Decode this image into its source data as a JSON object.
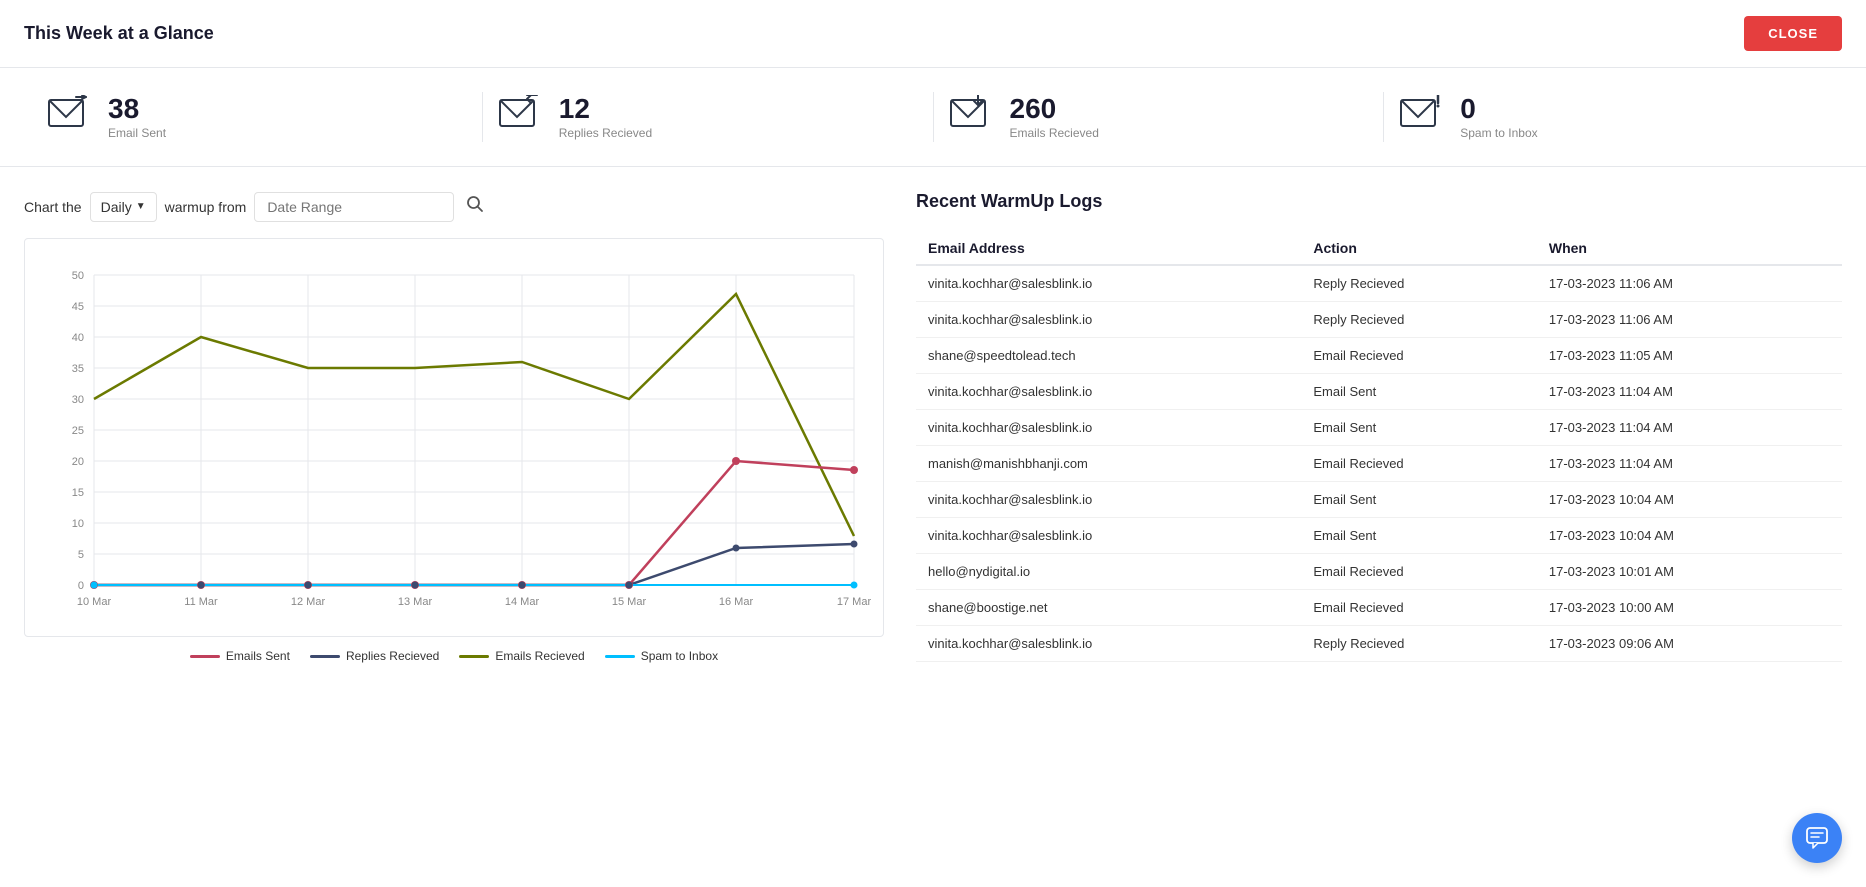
{
  "header": {
    "title": "This Week at a Glance",
    "close_label": "CLOSE"
  },
  "stats": [
    {
      "id": "email-sent",
      "value": "38",
      "label": "Email Sent",
      "icon": "send-email"
    },
    {
      "id": "replies-received",
      "value": "12",
      "label": "Replies Recieved",
      "icon": "reply-email"
    },
    {
      "id": "emails-received",
      "value": "260",
      "label": "Emails Recieved",
      "icon": "inbox-email"
    },
    {
      "id": "spam-to-inbox",
      "value": "0",
      "label": "Spam to Inbox",
      "icon": "spam-email"
    }
  ],
  "chart": {
    "controls": {
      "prefix_label": "Chart the",
      "dropdown_value": "Daily",
      "suffix_label": "warmup from",
      "date_range_placeholder": "Date Range"
    },
    "x_labels": [
      "10 Mar",
      "11 Mar",
      "12 Mar",
      "13 Mar",
      "14 Mar",
      "15 Mar",
      "16 Mar",
      "17 Mar"
    ],
    "y_labels": [
      "0",
      "5",
      "10",
      "15",
      "20",
      "25",
      "30",
      "35",
      "40",
      "45",
      "50"
    ],
    "legend": [
      {
        "label": "Emails Sent",
        "color": "#c0405c"
      },
      {
        "label": "Replies Recieved",
        "color": "#3d4a6e"
      },
      {
        "label": "Emails Recieved",
        "color": "#6b7a00"
      },
      {
        "label": "Spam to Inbox",
        "color": "#00bfff"
      }
    ]
  },
  "recent_logs": {
    "title": "Recent WarmUp Logs",
    "columns": [
      "Email Address",
      "Action",
      "When"
    ],
    "rows": [
      {
        "email": "vinita.kochhar@salesblink.io",
        "action": "Reply Recieved",
        "when": "17-03-2023 11:06 AM"
      },
      {
        "email": "vinita.kochhar@salesblink.io",
        "action": "Reply Recieved",
        "when": "17-03-2023 11:06 AM"
      },
      {
        "email": "shane@speedtolead.tech",
        "action": "Email Recieved",
        "when": "17-03-2023 11:05 AM"
      },
      {
        "email": "vinita.kochhar@salesblink.io",
        "action": "Email Sent",
        "when": "17-03-2023 11:04 AM"
      },
      {
        "email": "vinita.kochhar@salesblink.io",
        "action": "Email Sent",
        "when": "17-03-2023 11:04 AM"
      },
      {
        "email": "manish@manishbhanji.com",
        "action": "Email Recieved",
        "when": "17-03-2023 11:04 AM"
      },
      {
        "email": "vinita.kochhar@salesblink.io",
        "action": "Email Sent",
        "when": "17-03-2023 10:04 AM"
      },
      {
        "email": "vinita.kochhar@salesblink.io",
        "action": "Email Sent",
        "when": "17-03-2023 10:04 AM"
      },
      {
        "email": "hello@nydigital.io",
        "action": "Email Recieved",
        "when": "17-03-2023 10:01 AM"
      },
      {
        "email": "shane@boostige.net",
        "action": "Email Recieved",
        "when": "17-03-2023 10:00 AM"
      },
      {
        "email": "vinita.kochhar@salesblink.io",
        "action": "Reply Recieved",
        "when": "17-03-2023 09:06 AM"
      }
    ]
  }
}
